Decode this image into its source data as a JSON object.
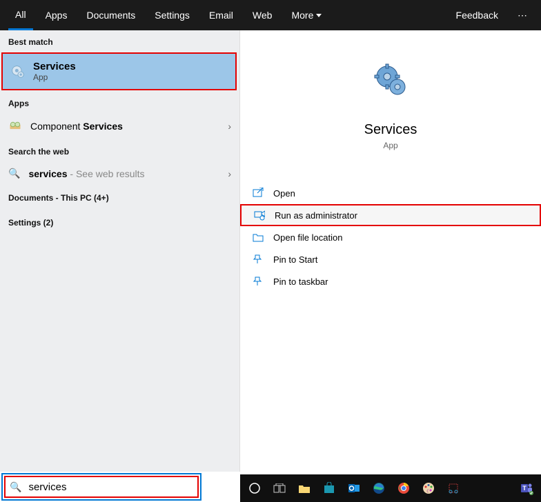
{
  "tabs": {
    "all": "All",
    "apps": "Apps",
    "documents": "Documents",
    "settings": "Settings",
    "email": "Email",
    "web": "Web",
    "more": "More",
    "feedback": "Feedback"
  },
  "left": {
    "best_match_label": "Best match",
    "best_match": {
      "title": "Services",
      "sub": "App"
    },
    "apps_label": "Apps",
    "component_prefix": "Component ",
    "component_bold": "Services",
    "search_web_label": "Search the web",
    "web_result_prefix": "services",
    "web_result_suffix": " - See web results",
    "documents_label": "Documents - This PC (4+)",
    "settings_label": "Settings (2)"
  },
  "right": {
    "title": "Services",
    "sub": "App",
    "actions": {
      "open": "Open",
      "run_admin": "Run as administrator",
      "open_location": "Open file location",
      "pin_start": "Pin to Start",
      "pin_taskbar": "Pin to taskbar"
    }
  },
  "search": {
    "value": "services"
  }
}
